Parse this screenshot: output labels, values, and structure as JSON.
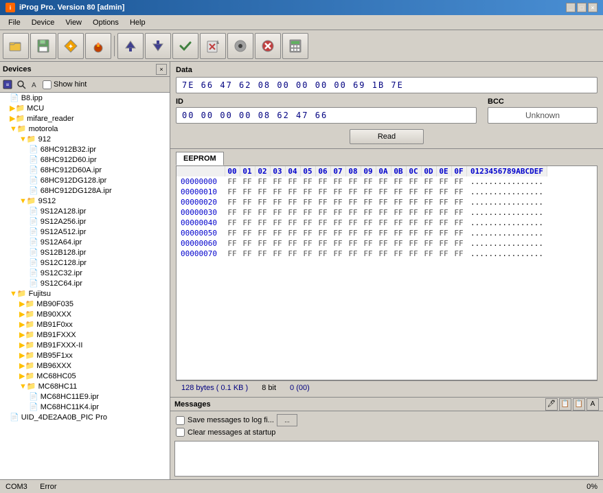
{
  "titleBar": {
    "title": "iProg Pro. Version 80 [admin]",
    "icon": "i"
  },
  "menuBar": {
    "items": [
      "File",
      "Device",
      "View",
      "Options",
      "Help"
    ]
  },
  "toolbar": {
    "buttons": [
      {
        "name": "open-button",
        "icon": "📂"
      },
      {
        "name": "save-button",
        "icon": "💾"
      },
      {
        "name": "new-button",
        "icon": "✨"
      },
      {
        "name": "burn-button",
        "icon": "🔥"
      },
      {
        "name": "upload-button",
        "icon": "⬆"
      },
      {
        "name": "download-button",
        "icon": "⬇"
      },
      {
        "name": "compare-button",
        "icon": "✔"
      },
      {
        "name": "erase-button",
        "icon": "🧹"
      },
      {
        "name": "device-button",
        "icon": "⚙"
      },
      {
        "name": "stop-button",
        "icon": "✖"
      },
      {
        "name": "calc-button",
        "icon": "🧮"
      }
    ]
  },
  "devicesPanel": {
    "title": "Devices",
    "showHint": "Show hint",
    "treeItems": [
      {
        "id": "b8ipp",
        "label": "B8.ipp",
        "indent": 1,
        "type": "file",
        "expanded": false
      },
      {
        "id": "mcu",
        "label": "MCU",
        "indent": 1,
        "type": "folder",
        "expanded": false
      },
      {
        "id": "mifare_reader",
        "label": "mifare_reader",
        "indent": 1,
        "type": "folder",
        "expanded": false
      },
      {
        "id": "motorola",
        "label": "motorola",
        "indent": 1,
        "type": "folder-open",
        "expanded": true
      },
      {
        "id": "912",
        "label": "912",
        "indent": 2,
        "type": "folder-open",
        "expanded": true
      },
      {
        "id": "68hc912b32",
        "label": "68HC912B32.ipr",
        "indent": 3,
        "type": "file"
      },
      {
        "id": "68hc912d60",
        "label": "68HC912D60.ipr",
        "indent": 3,
        "type": "file"
      },
      {
        "id": "68hc912d60a",
        "label": "68HC912D60A.ipr",
        "indent": 3,
        "type": "file"
      },
      {
        "id": "68hc912dg128",
        "label": "68HC912DG128.ipr",
        "indent": 3,
        "type": "file"
      },
      {
        "id": "68hc912dg128a",
        "label": "68HC912DG128A.ipr",
        "indent": 3,
        "type": "file"
      },
      {
        "id": "9s12",
        "label": "9S12",
        "indent": 2,
        "type": "folder-open",
        "expanded": true
      },
      {
        "id": "9s12a128",
        "label": "9S12A128.ipr",
        "indent": 3,
        "type": "file"
      },
      {
        "id": "9s12a256",
        "label": "9S12A256.ipr",
        "indent": 3,
        "type": "file"
      },
      {
        "id": "9s12a512",
        "label": "9S12A512.ipr",
        "indent": 3,
        "type": "file"
      },
      {
        "id": "9s12a64",
        "label": "9S12A64.ipr",
        "indent": 3,
        "type": "file"
      },
      {
        "id": "9s12b128",
        "label": "9S12B128.ipr",
        "indent": 3,
        "type": "file"
      },
      {
        "id": "9s12c128",
        "label": "9S12C128.ipr",
        "indent": 3,
        "type": "file"
      },
      {
        "id": "9s12c32",
        "label": "9S12C32.ipr",
        "indent": 3,
        "type": "file"
      },
      {
        "id": "9s12c64",
        "label": "9S12C64.ipr",
        "indent": 3,
        "type": "file"
      },
      {
        "id": "fujitsu",
        "label": "Fujitsu",
        "indent": 1,
        "type": "folder-open",
        "expanded": true
      },
      {
        "id": "mb90f035",
        "label": "MB90F035",
        "indent": 2,
        "type": "folder"
      },
      {
        "id": "mb90xxx",
        "label": "MB90XXX",
        "indent": 2,
        "type": "folder"
      },
      {
        "id": "mb91f0xx",
        "label": "MB91F0xx",
        "indent": 2,
        "type": "folder"
      },
      {
        "id": "mb91fxxx",
        "label": "MB91FXXX",
        "indent": 2,
        "type": "folder"
      },
      {
        "id": "mb91fxxx_i",
        "label": "MB91FXXX-II",
        "indent": 2,
        "type": "folder"
      },
      {
        "id": "mb95f1xx",
        "label": "MB95F1xx",
        "indent": 2,
        "type": "folder"
      },
      {
        "id": "mb96xxx",
        "label": "MB96XXX",
        "indent": 2,
        "type": "folder"
      },
      {
        "id": "mc68hc05",
        "label": "MC68HC05",
        "indent": 2,
        "type": "folder"
      },
      {
        "id": "mc68hc11",
        "label": "MC68HC11",
        "indent": 2,
        "type": "folder-open",
        "expanded": true
      },
      {
        "id": "mc68hc11e9",
        "label": "MC68HC11E9.ipr",
        "indent": 3,
        "type": "file"
      },
      {
        "id": "mc68hc11k4",
        "label": "MC68HC11K4.ipr",
        "indent": 3,
        "type": "file"
      },
      {
        "id": "uid_4de2aa0b",
        "label": "UID_4DE2AA0B_PIC Pro",
        "indent": 1,
        "type": "file"
      }
    ]
  },
  "dataSection": {
    "title": "Data",
    "dataValue": "7E  66  47  62  08  00  00  00  00  69  1B  7E",
    "id": {
      "label": "ID",
      "value": "00  00  00  00  08  62  47  66"
    },
    "bcc": {
      "label": "BCC",
      "value": "Unknown"
    },
    "readButton": "Read"
  },
  "eeprom": {
    "tabLabel": "EEPROM",
    "headers": [
      "",
      "00",
      "01",
      "02",
      "03",
      "04",
      "05",
      "06",
      "07",
      "08",
      "09",
      "0A",
      "0B",
      "0C",
      "0D",
      "0E",
      "0F",
      "0123456789ABCDEF"
    ],
    "rows": [
      {
        "addr": "00000000",
        "hex": [
          "FF",
          "FF",
          "FF",
          "FF",
          "FF",
          "FF",
          "FF",
          "FF",
          "FF",
          "FF",
          "FF",
          "FF",
          "FF",
          "FF",
          "FF",
          "FF"
        ],
        "ascii": "................"
      },
      {
        "addr": "00000010",
        "hex": [
          "FF",
          "FF",
          "FF",
          "FF",
          "FF",
          "FF",
          "FF",
          "FF",
          "FF",
          "FF",
          "FF",
          "FF",
          "FF",
          "FF",
          "FF",
          "FF"
        ],
        "ascii": "................"
      },
      {
        "addr": "00000020",
        "hex": [
          "FF",
          "FF",
          "FF",
          "FF",
          "FF",
          "FF",
          "FF",
          "FF",
          "FF",
          "FF",
          "FF",
          "FF",
          "FF",
          "FF",
          "FF",
          "FF"
        ],
        "ascii": "................"
      },
      {
        "addr": "00000030",
        "hex": [
          "FF",
          "FF",
          "FF",
          "FF",
          "FF",
          "FF",
          "FF",
          "FF",
          "FF",
          "FF",
          "FF",
          "FF",
          "FF",
          "FF",
          "FF",
          "FF"
        ],
        "ascii": "................"
      },
      {
        "addr": "00000040",
        "hex": [
          "FF",
          "FF",
          "FF",
          "FF",
          "FF",
          "FF",
          "FF",
          "FF",
          "FF",
          "FF",
          "FF",
          "FF",
          "FF",
          "FF",
          "FF",
          "FF"
        ],
        "ascii": "................"
      },
      {
        "addr": "00000050",
        "hex": [
          "FF",
          "FF",
          "FF",
          "FF",
          "FF",
          "FF",
          "FF",
          "FF",
          "FF",
          "FF",
          "FF",
          "FF",
          "FF",
          "FF",
          "FF",
          "FF"
        ],
        "ascii": "................"
      },
      {
        "addr": "00000060",
        "hex": [
          "FF",
          "FF",
          "FF",
          "FF",
          "FF",
          "FF",
          "FF",
          "FF",
          "FF",
          "FF",
          "FF",
          "FF",
          "FF",
          "FF",
          "FF",
          "FF"
        ],
        "ascii": "................"
      },
      {
        "addr": "00000070",
        "hex": [
          "FF",
          "FF",
          "FF",
          "FF",
          "FF",
          "FF",
          "FF",
          "FF",
          "FF",
          "FF",
          "FF",
          "FF",
          "FF",
          "FF",
          "FF",
          "FF"
        ],
        "ascii": "................"
      }
    ],
    "statusLeft": "128 bytes ( 0.1 KB )",
    "statusMid": "8 bit",
    "statusRight": "0 (00)"
  },
  "messages": {
    "title": "Messages",
    "saveToLog": "Save messages to log fi...",
    "clearAtStartup": "Clear messages at startup",
    "browseButton": "..."
  },
  "bottomStatus": {
    "left": "COM3",
    "right": "0%",
    "error": "Error"
  }
}
